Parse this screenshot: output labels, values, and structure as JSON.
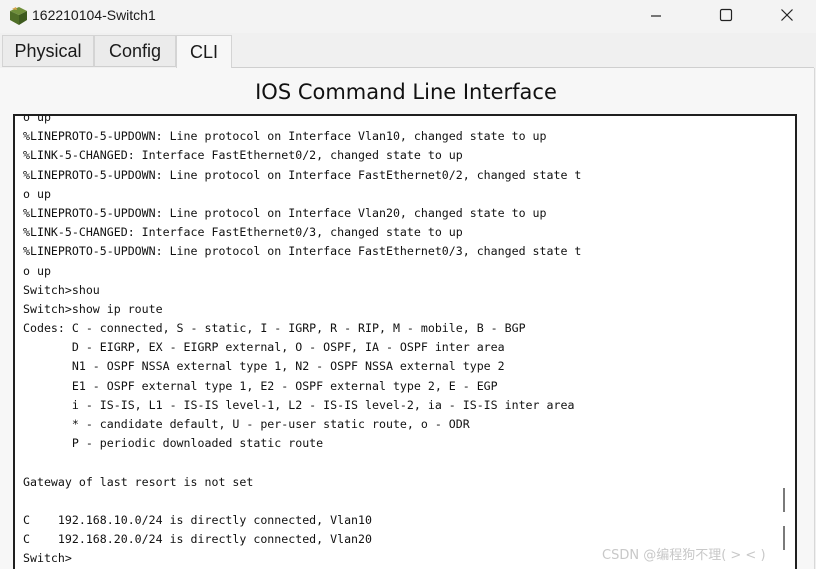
{
  "window": {
    "title": "162210104-Switch1",
    "icon": "packet-tracer-switch-icon",
    "controls": {
      "minimize": "minimize-icon",
      "maximize": "maximize-icon",
      "close": "close-icon"
    }
  },
  "tabs": [
    {
      "label": "Physical",
      "active": false
    },
    {
      "label": "Config",
      "active": false
    },
    {
      "label": "CLI",
      "active": true
    }
  ],
  "panel": {
    "heading": "IOS Command Line Interface"
  },
  "terminal": {
    "lines": [
      "o up",
      "%LINEPROTO-5-UPDOWN: Line protocol on Interface Vlan10, changed state to up",
      "%LINK-5-CHANGED: Interface FastEthernet0/2, changed state to up",
      "%LINEPROTO-5-UPDOWN: Line protocol on Interface FastEthernet0/2, changed state t",
      "o up",
      "%LINEPROTO-5-UPDOWN: Line protocol on Interface Vlan20, changed state to up",
      "%LINK-5-CHANGED: Interface FastEthernet0/3, changed state to up",
      "%LINEPROTO-5-UPDOWN: Line protocol on Interface FastEthernet0/3, changed state t",
      "o up",
      "Switch>shou",
      "Switch>show ip route",
      "Codes: C - connected, S - static, I - IGRP, R - RIP, M - mobile, B - BGP",
      "       D - EIGRP, EX - EIGRP external, O - OSPF, IA - OSPF inter area",
      "       N1 - OSPF NSSA external type 1, N2 - OSPF NSSA external type 2",
      "       E1 - OSPF external type 1, E2 - OSPF external type 2, E - EGP",
      "       i - IS-IS, L1 - IS-IS level-1, L2 - IS-IS level-2, ia - IS-IS inter area",
      "       * - candidate default, U - per-user static route, o - ODR",
      "       P - periodic downloaded static route",
      "",
      "Gateway of last resort is not set",
      "",
      "C    192.168.10.0/24 is directly connected, Vlan10",
      "C    192.168.20.0/24 is directly connected, Vlan20",
      "Switch>"
    ]
  },
  "watermark": "CSDN @编程狗不理( > < )"
}
